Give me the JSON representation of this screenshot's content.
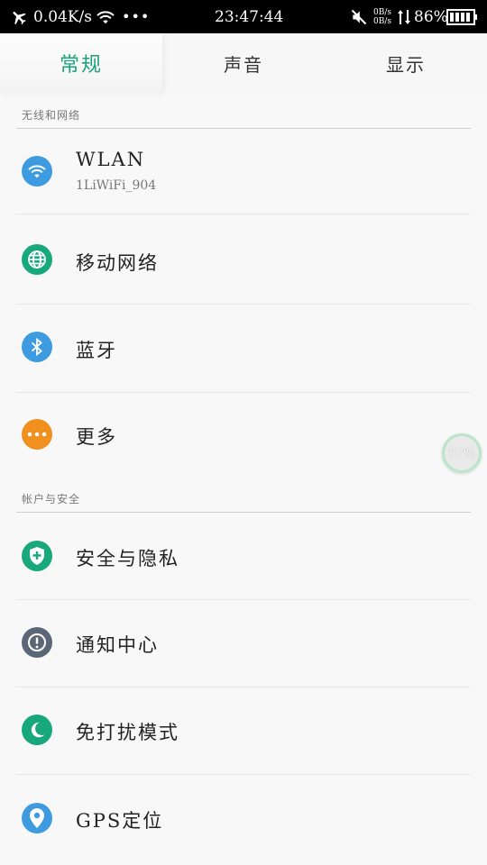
{
  "status_bar": {
    "speed": "0.04K/s",
    "time": "23:47:44",
    "net_up": "0B/s",
    "net_down": "0B/s",
    "battery": "86%",
    "icons": [
      "airplane-icon",
      "wifi-icon",
      "more-icon",
      "mute-icon",
      "data-arrows-icon",
      "battery-icon"
    ]
  },
  "tabs": [
    {
      "label": "常规",
      "active": true
    },
    {
      "label": "声音",
      "active": false
    },
    {
      "label": "显示",
      "active": false
    }
  ],
  "sections": [
    {
      "header": "无线和网络",
      "items": [
        {
          "label": "WLAN",
          "sub": "1LiWiFi_904",
          "icon": "wifi-icon",
          "color": "#3f9be0"
        },
        {
          "label": "移动网络",
          "icon": "globe-icon",
          "color": "#19a87c"
        },
        {
          "label": "蓝牙",
          "icon": "bluetooth-icon",
          "color": "#3f9be0"
        },
        {
          "label": "更多",
          "icon": "more-icon",
          "color": "#f0901f"
        }
      ]
    },
    {
      "header": "帐户与安全",
      "items": [
        {
          "label": "安全与隐私",
          "icon": "shield-icon",
          "color": "#19a87c"
        },
        {
          "label": "通知中心",
          "icon": "alert-icon",
          "color": "#5b6777"
        },
        {
          "label": "免打扰模式",
          "icon": "moon-icon",
          "color": "#19a87c"
        },
        {
          "label": "GPS定位",
          "icon": "location-icon",
          "color": "#3f9be0"
        }
      ]
    }
  ],
  "floating_badge": "57%",
  "colors": {
    "accent": "#1aa37a",
    "blue": "#3f9be0",
    "orange": "#f0901f",
    "gray": "#5b6777"
  }
}
